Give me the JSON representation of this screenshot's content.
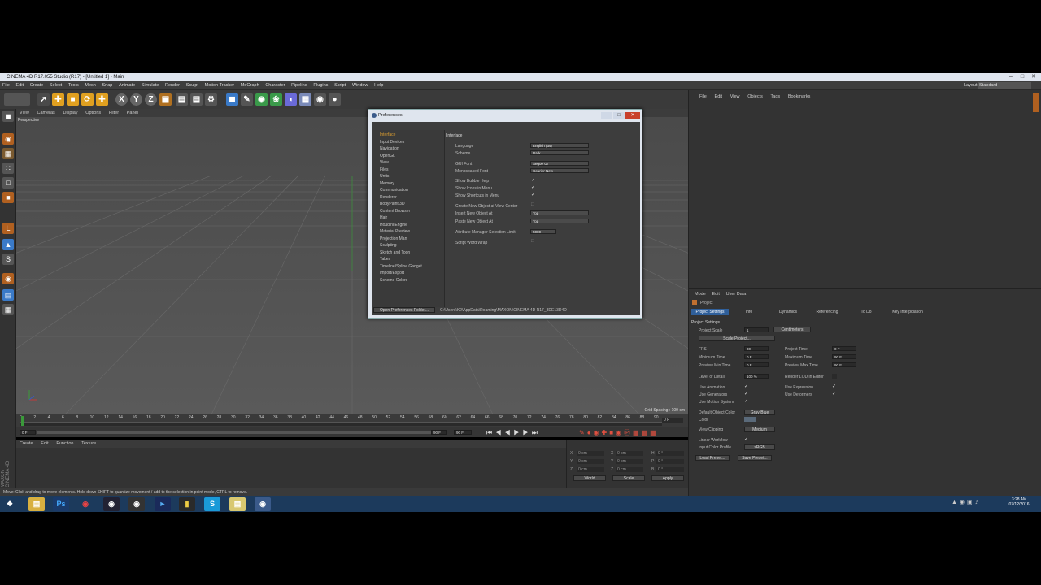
{
  "window": {
    "title": "CINEMA 4D R17.055 Studio (R17) - [Untitled 1] - Main",
    "layout_label": "Layout:",
    "layout_value": "Standard"
  },
  "menubar": [
    "File",
    "Edit",
    "Create",
    "Select",
    "Tools",
    "Mesh",
    "Snap",
    "Animate",
    "Simulate",
    "Render",
    "Sculpt",
    "Motion Tracker",
    "MoGraph",
    "Character",
    "Pipeline",
    "Plugins",
    "Script",
    "Window",
    "Help"
  ],
  "viewport": {
    "menu": [
      "View",
      "Cameras",
      "Display",
      "Options",
      "Filter",
      "Panel"
    ],
    "label": "Perspective",
    "grid_spacing": "Grid Spacing : 100 cm"
  },
  "timeline": {
    "ticks": [
      "0",
      "2",
      "4",
      "6",
      "8",
      "10",
      "12",
      "14",
      "16",
      "18",
      "20",
      "22",
      "24",
      "26",
      "28",
      "30",
      "32",
      "34",
      "36",
      "38",
      "40",
      "42",
      "44",
      "46",
      "48",
      "50",
      "52",
      "54",
      "56",
      "58",
      "60",
      "62",
      "64",
      "66",
      "68",
      "70",
      "72",
      "74",
      "76",
      "78",
      "80",
      "82",
      "84",
      "86",
      "88",
      "90"
    ],
    "end": "0 F",
    "start_field": "0 F",
    "end_field": "90 F",
    "cur": "90 F",
    "cur2": "90 F"
  },
  "material_menu": [
    "Create",
    "Edit",
    "Function",
    "Texture"
  ],
  "coords": {
    "rows": [
      [
        "X",
        "0 cm",
        "X",
        "0 cm",
        "H",
        "0 °"
      ],
      [
        "Y",
        "0 cm",
        "Y",
        "0 cm",
        "P",
        "0 °"
      ],
      [
        "Z",
        "0 cm",
        "Z",
        "0 cm",
        "B",
        "0 °"
      ]
    ],
    "world": "World",
    "scale": "Scale",
    "apply": "Apply"
  },
  "status": "Move: Click and drag to move elements. Hold down SHIFT to quantize movement / add to the selection in point mode, CTRL to remove.",
  "object_manager": {
    "menu": [
      "File",
      "Edit",
      "View",
      "Objects",
      "Tags",
      "Bookmarks"
    ]
  },
  "attribute_manager": {
    "menu": [
      "Mode",
      "Edit",
      "User Data"
    ],
    "section": "Project",
    "tabs": [
      "Project Settings",
      "Info",
      "Dynamics",
      "Referencing",
      "To Do",
      "Key Interpolation"
    ],
    "heading": "Project Settings",
    "project_scale_label": "Project Scale",
    "project_scale_value": "1",
    "project_scale_unit": "Centimeters",
    "scale_project": "Scale Project...",
    "fps_label": "FPS",
    "fps": "30",
    "project_time_label": "Project Time",
    "project_time": "0 F",
    "min_time_label": "Minimum Time",
    "min_time": "0 F",
    "max_time_label": "Maximum Time",
    "max_time": "90 F",
    "prev_min_label": "Preview Min Time",
    "prev_min": "0 F",
    "prev_max_label": "Preview Max Time",
    "prev_max": "90 F",
    "lod_label": "Level of Detail",
    "lod": "100 %",
    "render_lod_label": "Render LOD in Editor",
    "use_animation": "Use Animation",
    "use_expression": "Use Expression",
    "use_generators": "Use Generators",
    "use_deformers": "Use Deformers",
    "use_motion": "Use Motion System",
    "default_color_label": "Default Object Color",
    "default_color": "Gray-Blue",
    "color_label": "Color",
    "view_clipping_label": "View Clipping",
    "view_clipping": "Medium",
    "linear_label": "Linear Workflow",
    "input_profile_label": "Input Color Profile",
    "input_profile": "sRGB",
    "load_preset": "Load Preset...",
    "save_preset": "Save Preset..."
  },
  "preferences": {
    "title": "Preferences",
    "tree": [
      "Interface",
      "Input Devices",
      "Navigation",
      "OpenGL",
      "View",
      "Files",
      "Units",
      "Memory",
      "Communication",
      "Renderer",
      "BodyPaint 3D",
      "Content Browser",
      "Hair",
      "Houdini Engine",
      "Material Preview",
      "Projection Man",
      "Sculpting",
      "Sketch and Toon",
      "Takes",
      "Timeline/Spline Gadget",
      "Import/Export",
      "Scheme Colors"
    ],
    "heading": "Interface",
    "language_label": "Language",
    "language": "English (us)",
    "scheme_label": "Scheme",
    "scheme": "Dark",
    "gui_font_label": "GUI Font",
    "gui_font": "Segoe UI",
    "mono_font_label": "Monospaced Font",
    "mono_font": "Courier New",
    "bubble_label": "Show Bubble Help",
    "icons_label": "Show Icons in Menu",
    "shortcuts_label": "Show Shortcuts in Menu",
    "create_center_label": "Create New Object at View Center",
    "insert_label": "Insert New Object At",
    "insert": "Top",
    "paste_label": "Paste New Object At",
    "paste": "Top",
    "attr_limit_label": "Attribute Manager Selection Limit",
    "attr_limit": "5000",
    "word_wrap_label": "Script Word Wrap",
    "open_folder": "Open Preferences Folder...",
    "path": "C:\\Users\\K2\\AppData\\Roaming\\MAXON\\CINEMA 4D R17_8DE13D4D"
  },
  "taskbar": {
    "time": "3:28 AM",
    "date": "07/12/2016"
  }
}
